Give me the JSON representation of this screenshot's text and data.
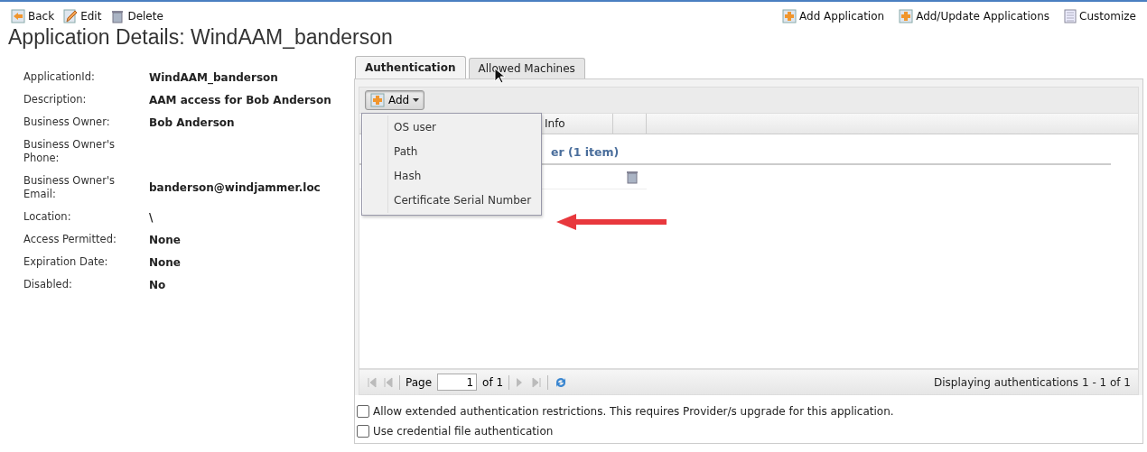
{
  "toolbar_left": [
    {
      "label": "Back",
      "kind": "back"
    },
    {
      "label": "Edit",
      "kind": "edit"
    },
    {
      "label": "Delete",
      "kind": "delete"
    }
  ],
  "toolbar_right": [
    {
      "label": "Add Application",
      "kind": "add"
    },
    {
      "label": "Add/Update Applications",
      "kind": "add"
    },
    {
      "label": "Customize",
      "kind": "customize"
    }
  ],
  "title": "Application Details: WindAAM_banderson",
  "details": [
    {
      "label": "ApplicationId:",
      "value": "WindAAM_banderson"
    },
    {
      "label": "Description:",
      "value": "AAM access for Bob Anderson"
    },
    {
      "label": "Business Owner:",
      "value": "Bob Anderson"
    },
    {
      "label": "Business Owner's Phone:"
    },
    {
      "label": "Business Owner's Email:",
      "value": "banderson@windjammer.loc"
    },
    {
      "label": "Location:",
      "value": "\\"
    },
    {
      "label": "Access Permitted:",
      "value": "None"
    },
    {
      "label": "Expiration Date:",
      "value": "None"
    },
    {
      "label": "Disabled:",
      "value": "No"
    }
  ],
  "tabs": [
    {
      "label": "Authentication",
      "selected": true
    },
    {
      "label": "Allowed Machines",
      "selected": false
    }
  ],
  "add_button": {
    "label": "Add",
    "expanded": true
  },
  "menu": [
    "OS user",
    "Path",
    "Hash",
    "Certificate Serial Number"
  ],
  "grid": {
    "column": "Info",
    "group": "er (1 item)"
  },
  "paging": {
    "page_label": "Page",
    "page": "1",
    "of": "of 1",
    "status": "Displaying authentications 1 - 1 of 1"
  },
  "options": [
    {
      "label": "Allow extended authentication restrictions. This requires Provider/s upgrade for this application.",
      "checked": false
    },
    {
      "label": "Use credential file authentication",
      "checked": false
    }
  ]
}
